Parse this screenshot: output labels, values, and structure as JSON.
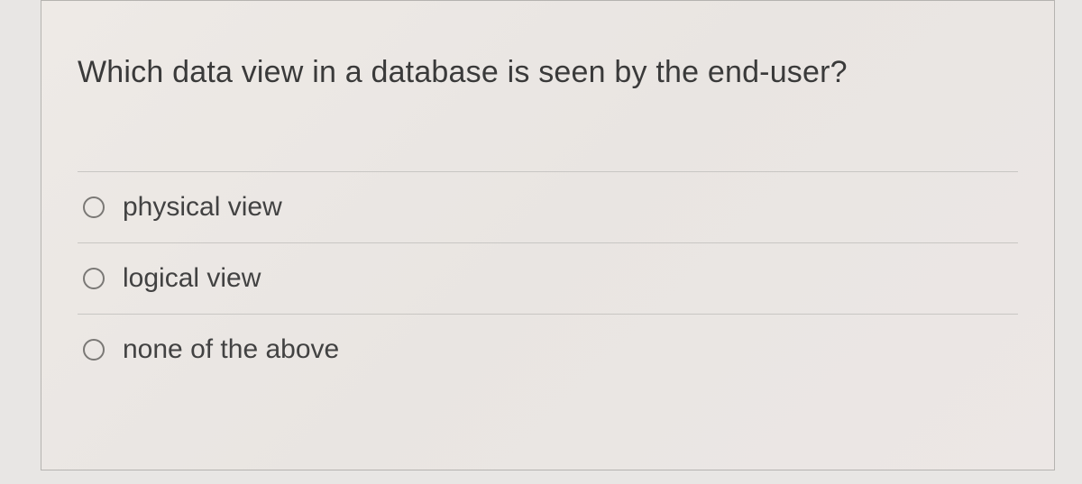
{
  "question": {
    "text": "Which data view in a database is seen by the end-user?"
  },
  "options": [
    {
      "label": "physical view"
    },
    {
      "label": "logical view"
    },
    {
      "label": "none of the above"
    }
  ]
}
